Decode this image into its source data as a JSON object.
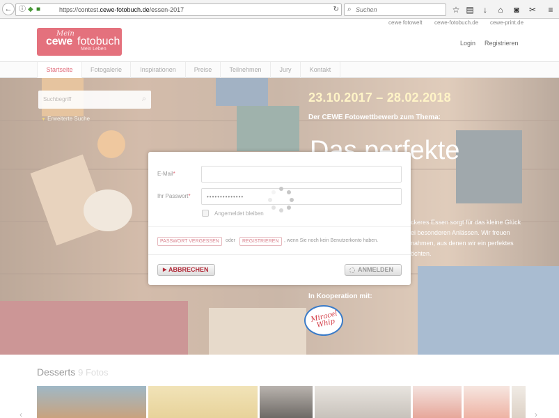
{
  "browser": {
    "url_prefix": "https://contest.",
    "url_domain": "cewe-fotobuch.de",
    "url_path": "/essen-2017",
    "search_placeholder": "Suchen"
  },
  "toplinks": [
    "cewe fotowelt",
    "cewe-fotobuch.de",
    "cewe-print.de"
  ],
  "logo": {
    "mein": "Mein",
    "cewe": "cewe",
    "fotobuch": "fotobuch",
    "tagline": "Mein Leben"
  },
  "header_links": {
    "login": "Login",
    "register": "Registrieren"
  },
  "menu": [
    "Startseite",
    "Fotogalerie",
    "Inspirationen",
    "Preise",
    "Teilnehmen",
    "Jury",
    "Kontakt"
  ],
  "hero": {
    "search_placeholder": "Suchbegriff",
    "advanced_search": "Erweiterte Suche",
    "date_range": "23.10.2017 – 28.02.2018",
    "subtitle": "Der CEWE Fotowettbewerb zum Thema:",
    "headline": "Das perfekte",
    "desc_line1": "ckeres Essen sorgt für das kleine Glück",
    "desc_line2": "ei besonderen Anlässen. Wir freuen",
    "desc_line3": "nahmen, aus denen wir ein perfektes",
    "desc_line4": "öchten.",
    "cooperation": "In Kooperation mit:",
    "partner_logo": "Miracel Whip"
  },
  "login_modal": {
    "email_label": "E-Mail",
    "password_label": "Ihr Passwort",
    "required_mark": "*",
    "password_value": "••••••••••••••",
    "remember_label": "Angemeldet bleiben",
    "forgot_password": "PASSWORT VERGESSEN",
    "or_text": "oder",
    "register": "REGISTRIEREN",
    "register_hint": ", wenn Sie noch kein Benutzerkonto haben.",
    "cancel_button": "ABBRECHEN",
    "login_button": "ANMELDEN"
  },
  "gallery": {
    "title": "Desserts",
    "count": "9 Fotos"
  },
  "colors": {
    "brand_pink": "#e4717d",
    "accent_red": "#b12b39",
    "date_yellow": "#fff4c7"
  }
}
